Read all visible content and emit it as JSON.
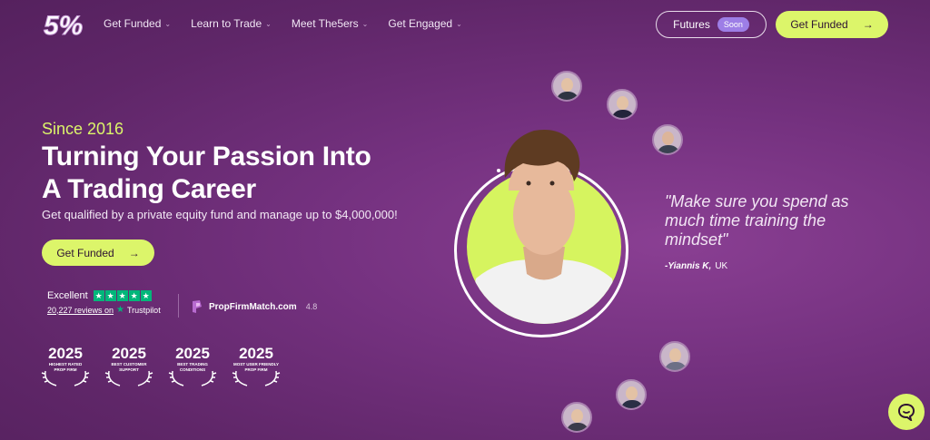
{
  "nav": {
    "logo_text": "5%",
    "menu": [
      {
        "label": "Get Funded"
      },
      {
        "label": "Learn to Trade"
      },
      {
        "label": "Meet The5ers"
      },
      {
        "label": "Get Engaged"
      }
    ],
    "futures_label": "Futures",
    "soon_badge": "Soon",
    "get_funded_label": "Get Funded"
  },
  "hero": {
    "since": "Since 2016",
    "headline_line1": "Turning Your Passion Into",
    "headline_line2": "A Trading Career",
    "subline": "Get qualified by a private equity fund and manage up to $4,000,000!",
    "cta_label": "Get Funded"
  },
  "trustpilot": {
    "rating_word": "Excellent",
    "stars": 5,
    "reviews_text": "20,227 reviews on",
    "brand": "Trustpilot"
  },
  "propfirmmatch": {
    "name": "PropFirmMatch.com",
    "score": "4.8"
  },
  "awards": [
    {
      "year": "2025",
      "label_line1": "HIGHEST RATED",
      "label_line2": "PROP FIRM"
    },
    {
      "year": "2025",
      "label_line1": "BEST CUSTOMER",
      "label_line2": "SUPPORT"
    },
    {
      "year": "2025",
      "label_line1": "BEST TRADING",
      "label_line2": "CONDITIONS"
    },
    {
      "year": "2025",
      "label_line1": "MOST USER FRIENDLY",
      "label_line2": "PROP FIRM"
    }
  ],
  "testimonial": {
    "quote": "\"Make sure you spend as much time training the mindset\"",
    "author": "-Yiannis K,",
    "country": "UK"
  },
  "colors": {
    "accent": "#dcf56a",
    "background": "#74317f",
    "trustpilot_green": "#00b67a",
    "soon_badge": "#9d7ee6"
  }
}
